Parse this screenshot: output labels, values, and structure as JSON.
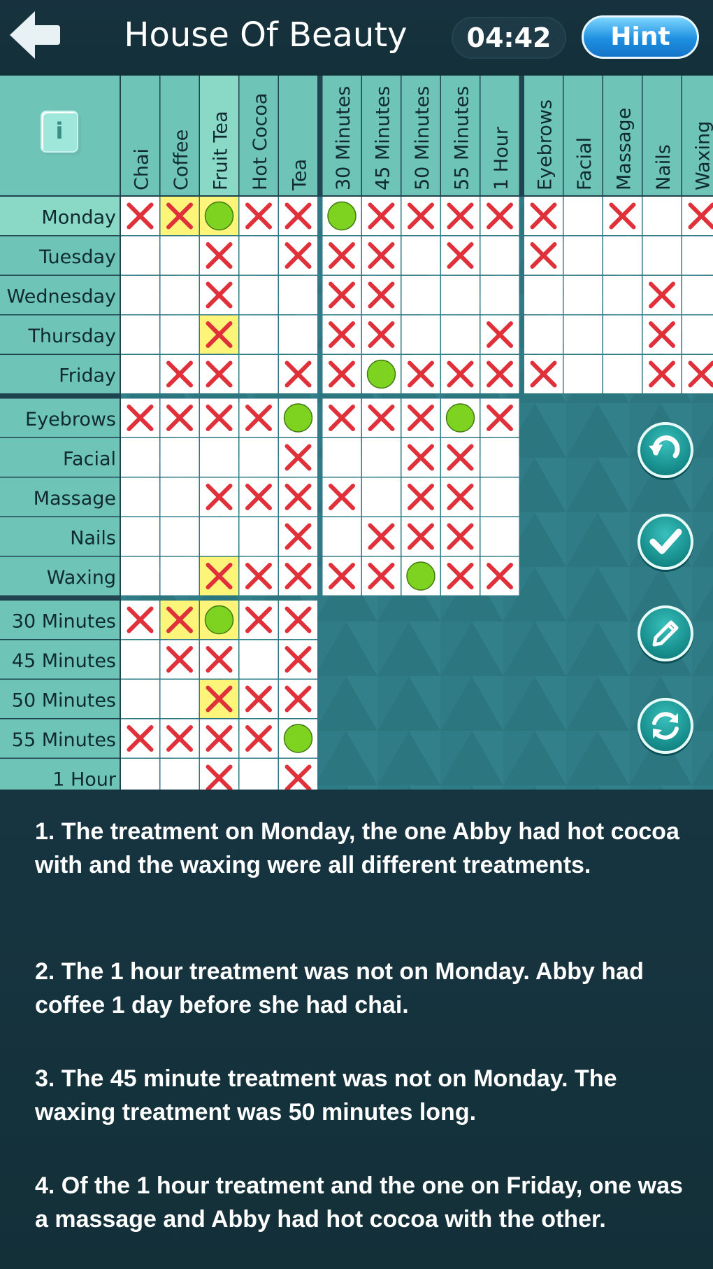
{
  "header": {
    "title": "House Of Beauty",
    "timer": "04:42",
    "hint_label": "Hint",
    "back_icon": "arrow-left-icon"
  },
  "info_label": "i",
  "columns": [
    "Chai",
    "Coffee",
    "Fruit Tea",
    "Hot Cocoa",
    "Tea",
    "30 Minutes",
    "45 Minutes",
    "50 Minutes",
    "55 Minutes",
    "1 Hour",
    "Eyebrows",
    "Facial",
    "Massage",
    "Nails",
    "Waxing"
  ],
  "rows": [
    "Monday",
    "Tuesday",
    "Wednesday",
    "Thursday",
    "Friday",
    "Eyebrows",
    "Facial",
    "Massage",
    "Nails",
    "Waxing",
    "30 Minutes",
    "45 Minutes",
    "50 Minutes",
    "55 Minutes",
    "1 Hour"
  ],
  "highlight_row": "Monday",
  "highlight_col": "Fruit Tea",
  "cells": [
    "XXOXXOXXXXX.X.X",
    "..X.XXX.X.X....",
    "..X..XX......X.",
    "..X..XX..X...X.",
    ".XX.XXOXXXX..XX",
    "XXXXOXXXOX",
    "....X..XX.",
    "..XXXX.XX.",
    "....X.XXX.",
    "..XXXXXOXX",
    "XXOXX",
    ".XX.X",
    "..XXX",
    "XXXXO",
    "..X.X"
  ],
  "yellow_cells": [
    [
      0,
      1
    ],
    [
      0,
      2
    ],
    [
      3,
      2
    ],
    [
      9,
      2
    ],
    [
      10,
      1
    ],
    [
      10,
      2
    ],
    [
      12,
      2
    ]
  ],
  "side_buttons": [
    "undo-icon",
    "check-icon",
    "pencil-icon",
    "refresh-icon"
  ],
  "colors": {
    "header_bg": "#17323e",
    "board_bg": "#2f7c86",
    "label_bg": "#6fc4b8",
    "cell_bg": "#ffffff",
    "highlight_bg": "#fdf47a",
    "cross": "#e0303a",
    "mark": "#7ed320",
    "grid_sep": "#1f4450",
    "hint_blue": "#1e8fe0"
  },
  "clues": [
    "1. The treatment on Monday, the one Abby had hot cocoa with and the waxing were all different treatments.",
    "2. The 1 hour treatment was not on Monday. Abby had coffee 1 day before she had chai.",
    "3. The 45 minute treatment was not on Monday. The waxing treatment was 50 minutes long.",
    "4. Of the 1 hour treatment and the one on Friday, one was a massage and Abby had hot cocoa with the other."
  ]
}
